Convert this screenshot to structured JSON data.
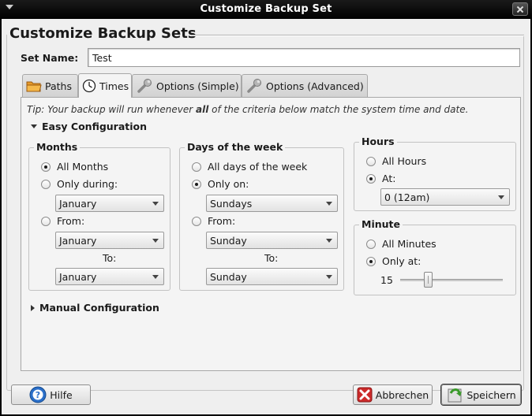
{
  "window": {
    "title": "Customize Backup Set"
  },
  "heading": "Customize Backup Sets",
  "set_name": {
    "label": "Set Name:",
    "value": "Test"
  },
  "tabs": [
    {
      "label": "Paths",
      "icon": "folder-icon"
    },
    {
      "label": "Times",
      "icon": "clock-icon",
      "active": true
    },
    {
      "label": "Options (Simple)",
      "icon": "wrench-icon"
    },
    {
      "label": "Options (Advanced)",
      "icon": "wrench-icon"
    }
  ],
  "tip": {
    "prefix": "Tip: Your backup will run whenever ",
    "emphasis": "all",
    "suffix": " of the criteria below match the system time and date."
  },
  "easy_config": {
    "label": "Easy Configuration",
    "months": {
      "title": "Months",
      "all_label": "All Months",
      "only_label": "Only during:",
      "only_value": "January",
      "from_label": "From:",
      "from_value": "January",
      "to_label": "To:",
      "to_value": "January",
      "selected": "all"
    },
    "days": {
      "title": "Days of the week",
      "all_label": "All days of the week",
      "only_label": "Only on:",
      "only_value": "Sundays",
      "from_label": "From:",
      "from_value": "Sunday",
      "to_label": "To:",
      "to_value": "Sunday",
      "selected": "only"
    },
    "hours": {
      "title": "Hours",
      "all_label": "All Hours",
      "at_label": "At:",
      "at_value": "0 (12am)",
      "selected": "at"
    },
    "minute": {
      "title": "Minute",
      "all_label": "All Minutes",
      "only_label": "Only at:",
      "value": "15",
      "min": 0,
      "max": 59,
      "selected": "only"
    }
  },
  "manual_config": {
    "label": "Manual Configuration"
  },
  "buttons": {
    "help": "Hilfe",
    "cancel": "Abbrechen",
    "save": "Speichern"
  },
  "colors": {
    "titlebar": "#000000",
    "background": "#efefef",
    "help_icon": "#2a6fc9",
    "cancel_icon": "#cc2a2a",
    "save_icon": "#3a9a2a"
  }
}
